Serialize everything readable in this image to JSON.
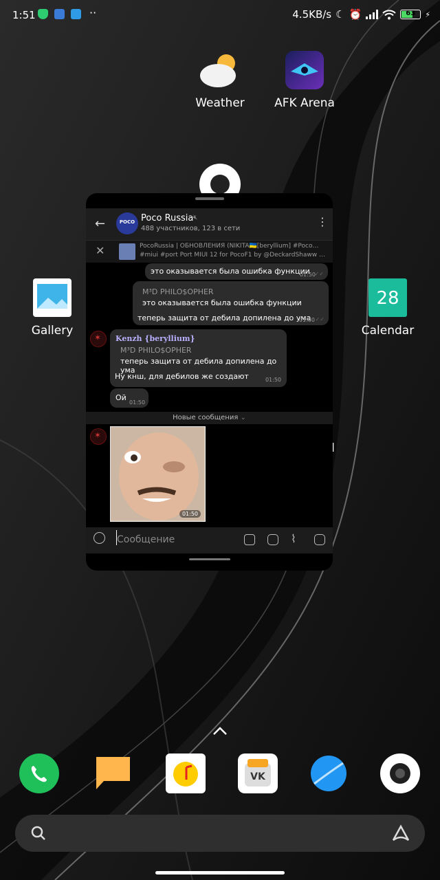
{
  "status": {
    "time": "1:51",
    "net_speed": "4.5KB/s",
    "battery": "63",
    "battery_fraction": 0.63,
    "dots": "··"
  },
  "home": {
    "apps": [
      {
        "label": "Weather"
      },
      {
        "label": "AFK Arena"
      },
      {
        "label": "Gallery"
      },
      {
        "label": "Calendar",
        "date": "28"
      }
    ],
    "partial_label": "d"
  },
  "chat": {
    "title": "Poco Russia",
    "avatar_text": "POCO",
    "subtitle": "488 участников, 123 в сети",
    "pinned_line1": "PocoRussia | ОБНОВЛЕНИЯ (NIKITA🇺🇦[beryllium] #Poco…",
    "pinned_line2": "#miui #port Port MIUI 12 for PocoF1 by @DeckardShaww …",
    "messages": {
      "m1_text": "это оказывается была ошибка функции",
      "m1_time": "01:50",
      "m2_fwd_author": "M³D PHILO$OPHER",
      "m2_fwd_text": "это оказывается была ошибка функции",
      "m2_text": "теперь защита от дебила допилена до ума",
      "m2_time": "01:50",
      "m3_author": "Kenzh {beryllium}",
      "m3_fwd_author": "M³D PHILO$OPHER",
      "m3_fwd_text": "теперь защита от дебила допилена до ума",
      "m3_text": "Ну кнш, для дебилов же создают",
      "m3_time": "01:50",
      "m4_text": "Ой",
      "m4_time": "01:50",
      "new_messages": "Новые сообщения",
      "photo_time": "01:50"
    },
    "input_placeholder": "Сообщение"
  },
  "colors": {
    "accent_green": "#4cd964",
    "phone": "#1fbf5a",
    "messages": "#ffb74d",
    "music": "#ffcc00",
    "browser": "#2196f3",
    "calendar": "#1abc9c"
  }
}
